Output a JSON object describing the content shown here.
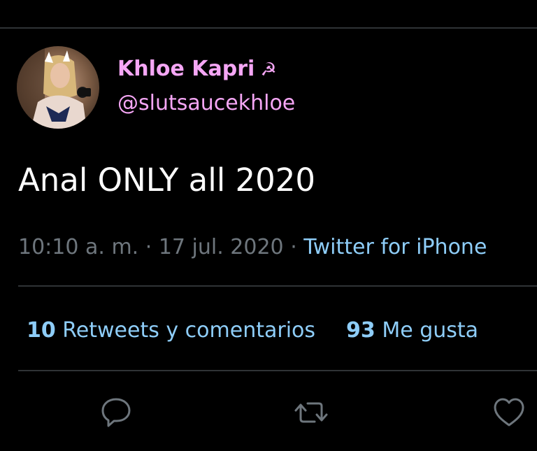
{
  "author": {
    "display_name": "Khloe Kapri",
    "name_emoji": "☭",
    "handle": "@slutsaucekhloe"
  },
  "tweet": {
    "text": "Anal ONLY all 2020"
  },
  "meta": {
    "time": "10:10 a. m.",
    "separator_1": " · ",
    "date": "17 jul. 2020",
    "separator_2": " · ",
    "source": "Twitter for iPhone"
  },
  "stats": {
    "retweets_count": "10",
    "retweets_label": "Retweets y comentarios",
    "likes_count": "93",
    "likes_label": "Me gusta"
  },
  "actions": {
    "reply_icon": "reply-icon",
    "retweet_icon": "retweet-icon",
    "like_icon": "heart-icon"
  },
  "colors": {
    "background": "#000000",
    "name": "#f5a6f5",
    "accent": "#8ecdf8",
    "muted": "#6e767d",
    "divider": "#2f3336"
  }
}
